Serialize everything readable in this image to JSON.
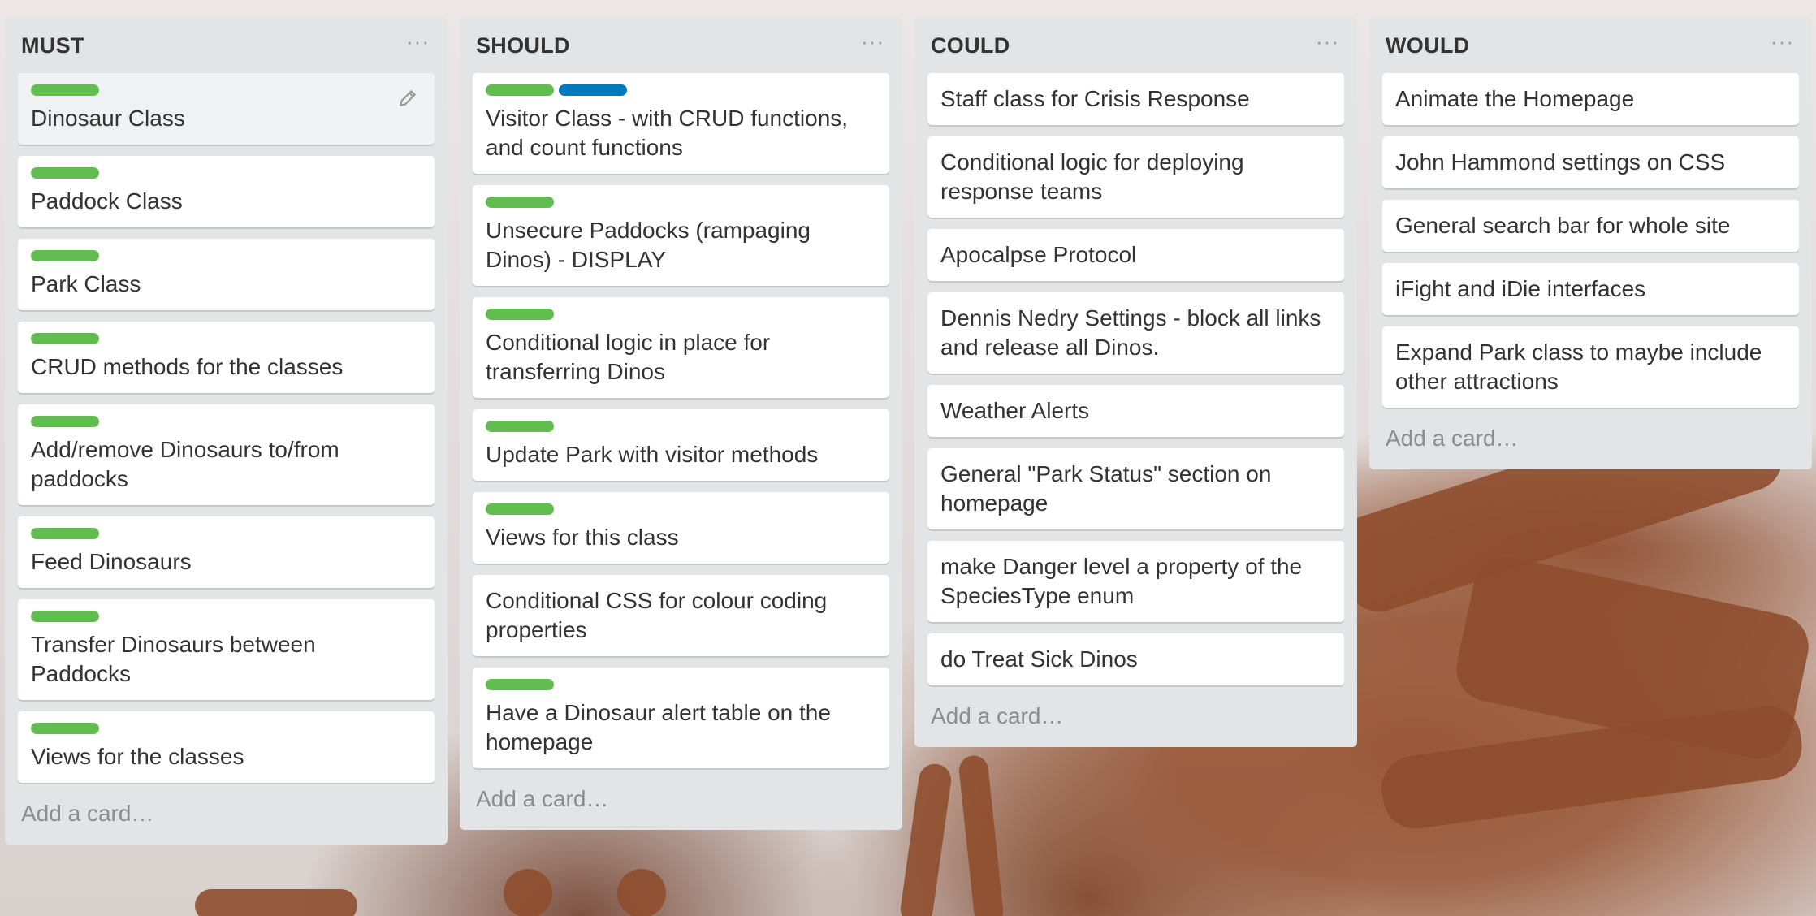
{
  "colors": {
    "list_bg": "#e2e4e6",
    "card_bg": "#ffffff",
    "label_green": "#61bd4f",
    "label_blue": "#0079bf",
    "text": "#333333",
    "muted": "#8c8c8c"
  },
  "icons": {
    "list_menu": "ellipsis-icon",
    "card_edit": "pencil-icon"
  },
  "lists": [
    {
      "title": "MUST",
      "menu": "···",
      "add_card": "Add a card…",
      "cards": [
        {
          "title": "Dinosaur Class",
          "labels": [
            "green"
          ]
        },
        {
          "title": "Paddock Class",
          "labels": [
            "green"
          ]
        },
        {
          "title": "Park Class",
          "labels": [
            "green"
          ]
        },
        {
          "title": "CRUD methods for the classes",
          "labels": [
            "green"
          ]
        },
        {
          "title": "Add/remove Dinosaurs to/from paddocks",
          "labels": [
            "green"
          ]
        },
        {
          "title": "Feed Dinosaurs",
          "labels": [
            "green"
          ]
        },
        {
          "title": "Transfer Dinosaurs between Paddocks",
          "labels": [
            "green"
          ]
        },
        {
          "title": "Views for the classes",
          "labels": [
            "green"
          ]
        }
      ]
    },
    {
      "title": "SHOULD",
      "menu": "···",
      "add_card": "Add a card…",
      "cards": [
        {
          "title": "Visitor Class - with CRUD functions, and count functions",
          "labels": [
            "green",
            "blue"
          ]
        },
        {
          "title": "Unsecure Paddocks (rampaging Dinos) - DISPLAY",
          "labels": [
            "green"
          ]
        },
        {
          "title": "Conditional logic in place for transferring Dinos",
          "labels": [
            "green"
          ]
        },
        {
          "title": "Update Park with visitor methods",
          "labels": [
            "green"
          ]
        },
        {
          "title": "Views for this class",
          "labels": [
            "green"
          ]
        },
        {
          "title": "Conditional CSS for colour coding properties",
          "labels": []
        },
        {
          "title": "Have a Dinosaur alert table on the homepage",
          "labels": [
            "green"
          ]
        }
      ]
    },
    {
      "title": "COULD",
      "menu": "···",
      "add_card": "Add a card…",
      "cards": [
        {
          "title": "Staff class for Crisis Response",
          "labels": []
        },
        {
          "title": "Conditional logic for deploying response teams",
          "labels": []
        },
        {
          "title": "Apocalpse Protocol",
          "labels": []
        },
        {
          "title": "Dennis Nedry Settings - block all links and release all Dinos.",
          "labels": []
        },
        {
          "title": "Weather Alerts",
          "labels": []
        },
        {
          "title": "General \"Park Status\" section on homepage",
          "labels": []
        },
        {
          "title": "make Danger level a property of the SpeciesType enum",
          "labels": []
        },
        {
          "title": "do Treat Sick Dinos",
          "labels": []
        }
      ]
    },
    {
      "title": "WOULD",
      "menu": "···",
      "add_card": "Add a card…",
      "cards": [
        {
          "title": "Animate the Homepage",
          "labels": []
        },
        {
          "title": "John Hammond settings on CSS",
          "labels": []
        },
        {
          "title": "General search bar for whole site",
          "labels": []
        },
        {
          "title": "iFight and iDie interfaces",
          "labels": []
        },
        {
          "title": "Expand Park class to maybe include other attractions",
          "labels": []
        }
      ]
    }
  ]
}
